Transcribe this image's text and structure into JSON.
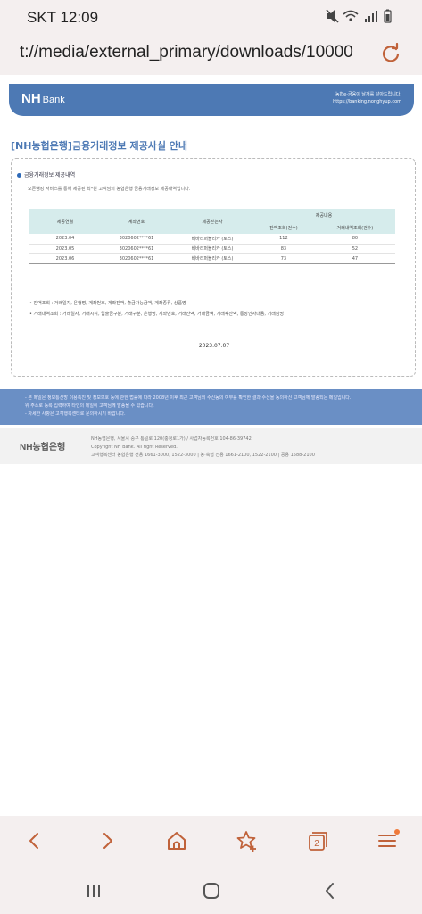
{
  "status": {
    "time": "SKT 12:09",
    "icons": [
      "mute-icon",
      "wifi-icon",
      "signal-icon",
      "battery-icon"
    ]
  },
  "browser": {
    "url": "t://media/external_primary/downloads/10000",
    "tab_count": "2"
  },
  "nh": {
    "logo": "NH",
    "logo_sub": "Bank",
    "header_line1": "농협e-금융이 날개를 달아드립니다.",
    "header_line2": "https://banking.nonghyup.com"
  },
  "doc": {
    "title": "[NH농협은행]금융거래정보 제공사실 안내",
    "section_title": "금융거래정보 제공내역",
    "section_desc": "오픈뱅킹 서비스를 통해 제공된 최*원 고객님의 농협은행 금융거래정보 제공내역입니다.",
    "table": {
      "headers": [
        "제공연월",
        "계좌번호",
        "제공받는자",
        "제공내용"
      ],
      "subheaders": [
        "잔액조회(건수)",
        "거래내역조회(건수)"
      ],
      "rows": [
        {
          "month": "2023.04",
          "account": "3020602****61",
          "recipient": "비바리퍼블리카 (토스)",
          "balance": "112",
          "history": "80"
        },
        {
          "month": "2023.05",
          "account": "3020602****61",
          "recipient": "비바리퍼블리카 (토스)",
          "balance": "83",
          "history": "52"
        },
        {
          "month": "2023.06",
          "account": "3020602****61",
          "recipient": "비바리퍼블리카 (토스)",
          "balance": "73",
          "history": "47"
        }
      ]
    },
    "note1": "• 잔액조회 : 거래일자, 은행명, 계좌번호, 계좌잔액, 출금가능금액, 계좌종류, 상품명",
    "note2": "• 거래내역조회 : 거래일자, 거래시각, 입출금구분, 거래구분, 은행명, 계좌번호, 거래잔액, 거래금액, 거래후잔액, 통장인자내용, 거래점명",
    "date": "2023.07.07"
  },
  "notice": {
    "line1": "- 본 메일은 정보통신망 이용촉진 및 정보보호 등에 관한 법률에 따라 2008년 이후 최근 고객님의 수신동의 여부를 확인한 결과 수신을 동의하신 고객님께 발송되는 메일입니다.",
    "line2": "  위 주소로 등록 입력하여 타인의 메일이 고객님께 발송될 수 있습니다.",
    "line3": "- 자세한 사항은 고객행복센터로 문의하시기 바랍니다."
  },
  "footer": {
    "logo": "NH농협은행",
    "line1": "NH농협은행, 서울시 중구 통일로 120(충정로1가) / 사업자등록번호 104-86-39742",
    "line2": "Copyright NH Bank. All right Reserved.",
    "line3": "고객행복센터 농협은행 전용 1661-3000, 1522-3000 | 농·축협 전용 1661-2100, 1522-2100 | 공용 1588-2100"
  },
  "colors": {
    "nh_blue": "#4d79b4",
    "toolbar_accent": "#c0623a",
    "notification_dot": "#f07a3a"
  }
}
